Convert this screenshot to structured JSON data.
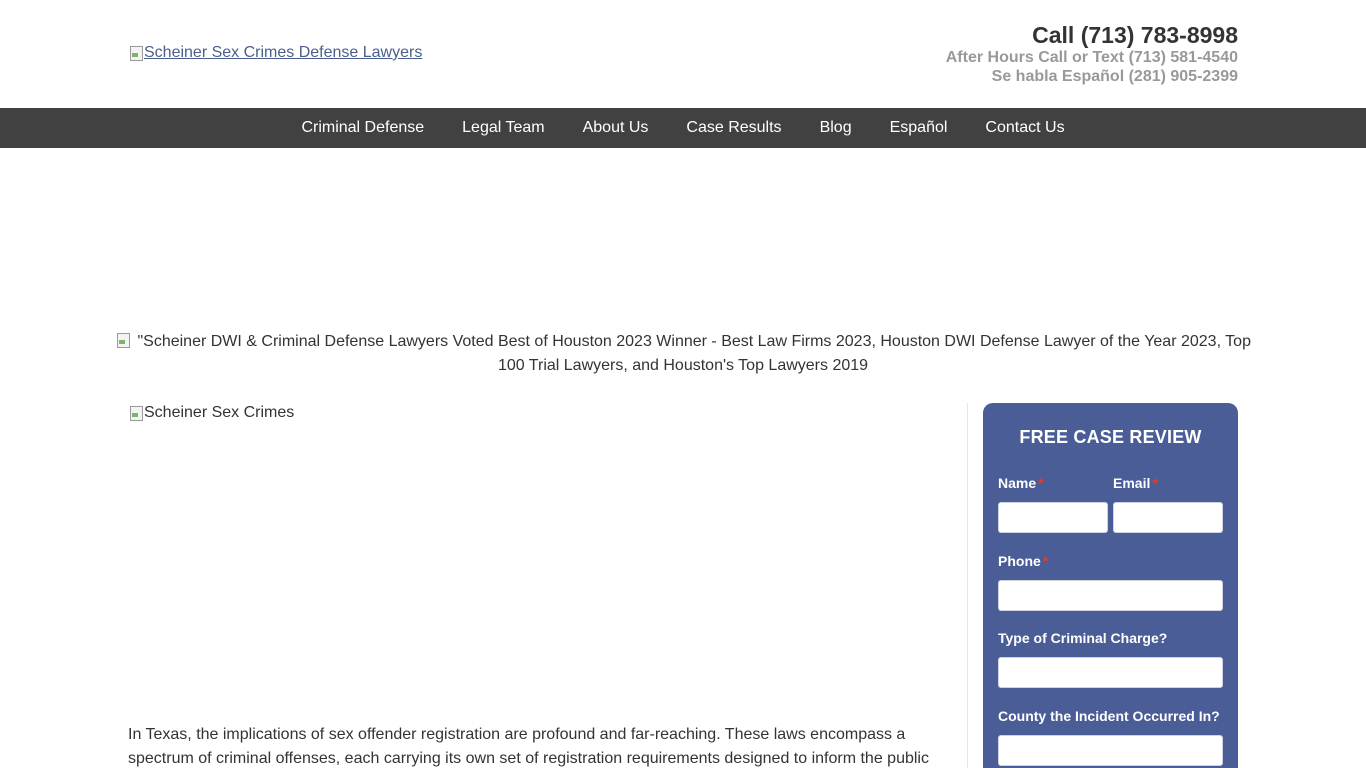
{
  "header": {
    "logo_alt": "Scheiner Sex Crimes Defense Lawyers",
    "call": "Call (713) 783-8998",
    "after_hours": "After Hours Call or Text (713) 581-4540",
    "espanol": "Se habla Español (281) 905-2399"
  },
  "nav": {
    "items": [
      "Criminal Defense",
      "Legal Team",
      "About Us",
      "Case Results",
      "Blog",
      "Español",
      "Contact Us"
    ]
  },
  "award": {
    "alt_text": "\"Scheiner DWI & Criminal Defense Lawyers Voted Best of Houston 2023 Winner - Best Law Firms 2023, Houston DWI Defense Lawyer of the Year 2023, Top 100 Trial Lawyers, and Houston's Top Lawyers 2019"
  },
  "main": {
    "image_alt": "Scheiner Sex Crimes",
    "paragraph": "In Texas, the implications of sex offender registration are profound and far-reaching. These laws encompass a spectrum of criminal offenses, each carrying its own set of registration requirements designed to inform the public"
  },
  "form": {
    "title": "FREE CASE REVIEW",
    "name_label": "Name",
    "email_label": "Email",
    "phone_label": "Phone",
    "charge_label": "Type of Criminal Charge?",
    "county_label": "County the Incident Occurred In?",
    "required_mark": "*"
  },
  "colors": {
    "nav_bg": "#414141",
    "form_bg": "#4a5d96",
    "required": "#e03c31"
  }
}
